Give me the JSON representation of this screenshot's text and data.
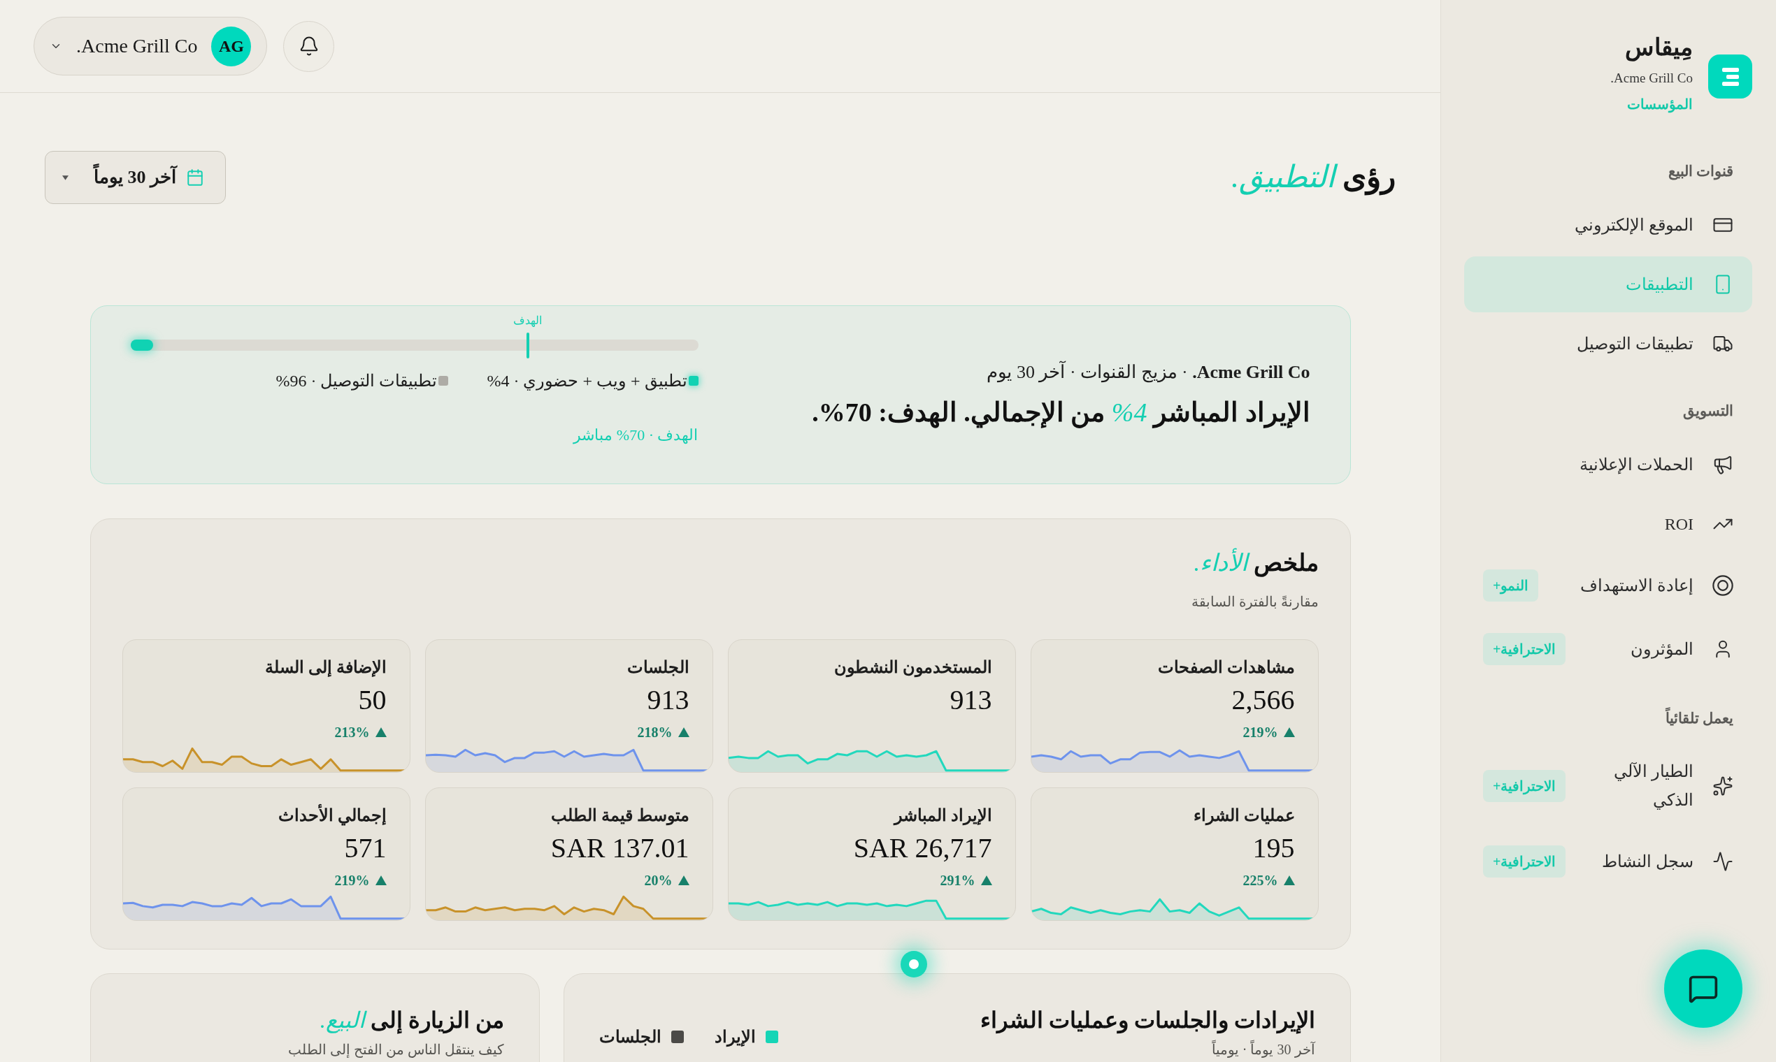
{
  "header": {
    "org_switcher": {
      "initials": "AG",
      "name": "Acme Grill Co."
    }
  },
  "page_title": {
    "text": "رؤى",
    "highlight": "التطبيق."
  },
  "date_range": {
    "label": "آخر 30 يوماً"
  },
  "channel_mix": {
    "context": "**Acme Grill Co.** · مزيج القنوات · آخر 30 يوم",
    "headline": {
      "text": "الإيراد المباشر",
      "highlight": "4%",
      "rest": "من الإجمالي. الهدف: 70%."
    },
    "bar": {
      "level": 0.04,
      "goal": {
        "label": "الهدف",
        "level": 0.7
      }
    },
    "legend": [
      {
        "label": "تطبيق + ويب + حضوري · 4%",
        "color": "#10d2b3"
      },
      {
        "label": "تطبيقات التوصيل · 96%",
        "color": "#aeaca6"
      }
    ],
    "goal_note": "الهدف · 70% مباشر"
  },
  "performance": {
    "title": "ملخص",
    "highlight": "الأداء.",
    "subtitle": "مقارنةً بالفترة السابقة",
    "metrics": [
      {
        "label": "مشاهدات الصفحات",
        "value": "2,566",
        "change": "219%",
        "color": "#6e93ec"
      },
      {
        "label": "المستخدمون النشطون",
        "value": "913",
        "color": "#22d8bd"
      },
      {
        "label": "الجلسات",
        "value": "913",
        "change": "218%",
        "color": "#6e93ec"
      },
      {
        "label": "الإضافة إلى السلة",
        "value": "50",
        "change": "213%",
        "color": "#c8922a"
      },
      {
        "label": "عمليات الشراء",
        "value": "195",
        "change": "225%",
        "color": "#22d8bd"
      },
      {
        "label": "الإيراد المباشر",
        "value": "SAR 26,717",
        "change": "291%",
        "color": "#22d8bd"
      },
      {
        "label": "متوسط قيمة الطلب",
        "value": "SAR 137.01",
        "change": "20%",
        "color": "#c8922a"
      },
      {
        "label": "إجمالي الأحداث",
        "value": "571",
        "change": "219%",
        "color": "#6e93ec"
      }
    ]
  },
  "charts_row": [
    {
      "title": "الإيرادات والجلسات وعمليات الشراء",
      "subtitle": "آخر 30 يوماً · يومياً",
      "legend": [
        {
          "label": "الإيراد",
          "color": "#16d5b6"
        },
        {
          "label": "الجلسات",
          "color": "#4b4a47"
        }
      ]
    },
    {
      "title": "من الزيارة إلى",
      "highlight": "البيع.",
      "subtitle": "كيف ينتقل الناس من الفتح إلى الطلب"
    }
  ],
  "sidebar": {
    "brand": {
      "name": "مِيقاس",
      "org": "Acme Grill Co.",
      "plan": "المؤسسات"
    },
    "sections": [
      {
        "title": "قنوات البيع",
        "items": [
          {
            "label": "الموقع الإلكتروني",
            "selected": false
          },
          {
            "label": "التطبيقات",
            "selected": true
          },
          {
            "label": "تطبيقات التوصيل",
            "selected": false
          }
        ]
      },
      {
        "title": "التسويق",
        "items": [
          {
            "label": "الحملات الإعلانية",
            "selected": false
          },
          {
            "label": "ROI",
            "selected": false
          },
          {
            "label": "إعادة الاستهداف",
            "badge": "النمو+",
            "selected": false
          },
          {
            "label": "المؤثرون",
            "badge": "الاحترافية+",
            "selected": false
          }
        ]
      },
      {
        "title": "يعمل تلقائياً",
        "items": [
          {
            "label": "الطيار الآلي الذكي",
            "badge": "الاحترافية+",
            "selected": false
          },
          {
            "label": "سجل النشاط",
            "badge": "الاحترافية+",
            "selected": false
          }
        ]
      }
    ]
  }
}
